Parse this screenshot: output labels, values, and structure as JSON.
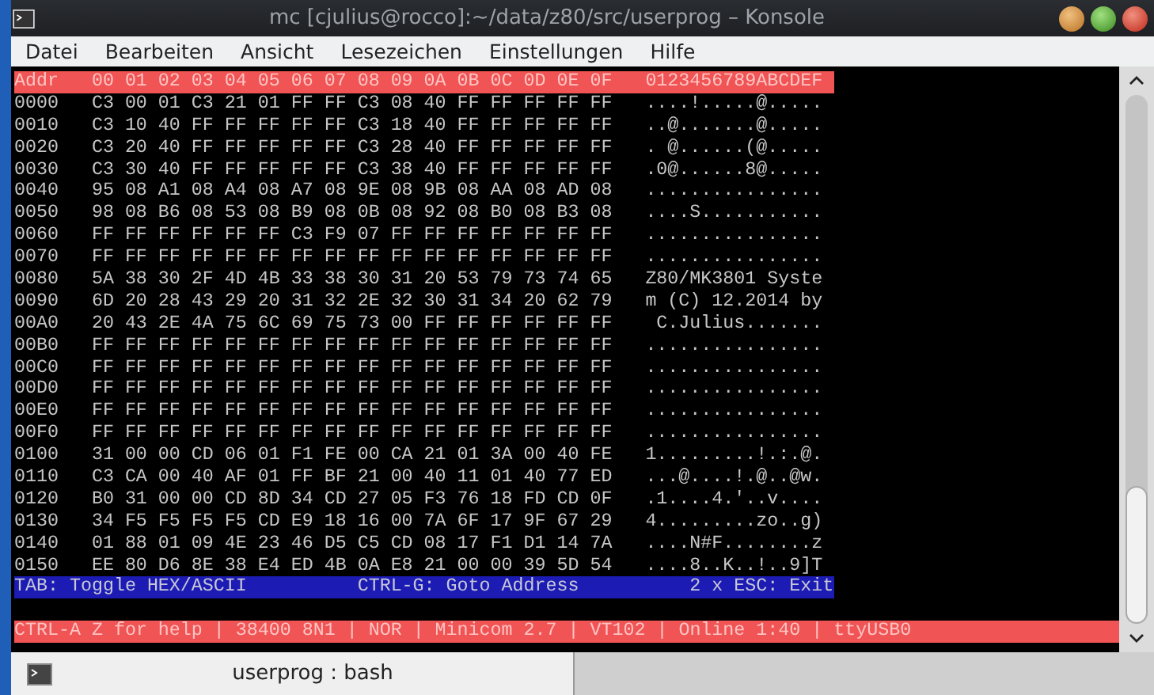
{
  "window": {
    "title": "mc [cjulius@rocco]:~/data/z80/src/userprog – Konsole"
  },
  "menu": [
    "Datei",
    "Bearbeiten",
    "Ansicht",
    "Lesezeichen",
    "Einstellungen",
    "Hilfe"
  ],
  "hexdump": {
    "header": {
      "addr": "Addr",
      "columns": "00 01 02 03 04 05 06 07 08 09 0A 0B 0C 0D 0E 0F",
      "ascii": "0123456789ABCDEF"
    },
    "rows": [
      {
        "addr": "0000",
        "hex": "C3 00 01 C3 21 01 FF FF C3 08 40 FF FF FF FF FF",
        "ascii": "....!.....@....."
      },
      {
        "addr": "0010",
        "hex": "C3 10 40 FF FF FF FF FF C3 18 40 FF FF FF FF FF",
        "ascii": "..@.......@....."
      },
      {
        "addr": "0020",
        "hex": "C3 20 40 FF FF FF FF FF C3 28 40 FF FF FF FF FF",
        "ascii": ". @......(@....."
      },
      {
        "addr": "0030",
        "hex": "C3 30 40 FF FF FF FF FF C3 38 40 FF FF FF FF FF",
        "ascii": ".0@......8@....."
      },
      {
        "addr": "0040",
        "hex": "95 08 A1 08 A4 08 A7 08 9E 08 9B 08 AA 08 AD 08",
        "ascii": "................"
      },
      {
        "addr": "0050",
        "hex": "98 08 B6 08 53 08 B9 08 0B 08 92 08 B0 08 B3 08",
        "ascii": "....S..........."
      },
      {
        "addr": "0060",
        "hex": "FF FF FF FF FF FF C3 F9 07 FF FF FF FF FF FF FF",
        "ascii": "................"
      },
      {
        "addr": "0070",
        "hex": "FF FF FF FF FF FF FF FF FF FF FF FF FF FF FF FF",
        "ascii": "................"
      },
      {
        "addr": "0080",
        "hex": "5A 38 30 2F 4D 4B 33 38 30 31 20 53 79 73 74 65",
        "ascii": "Z80/MK3801 Syste"
      },
      {
        "addr": "0090",
        "hex": "6D 20 28 43 29 20 31 32 2E 32 30 31 34 20 62 79",
        "ascii": "m (C) 12.2014 by"
      },
      {
        "addr": "00A0",
        "hex": "20 43 2E 4A 75 6C 69 75 73 00 FF FF FF FF FF FF",
        "ascii": " C.Julius......."
      },
      {
        "addr": "00B0",
        "hex": "FF FF FF FF FF FF FF FF FF FF FF FF FF FF FF FF",
        "ascii": "................"
      },
      {
        "addr": "00C0",
        "hex": "FF FF FF FF FF FF FF FF FF FF FF FF FF FF FF FF",
        "ascii": "................"
      },
      {
        "addr": "00D0",
        "hex": "FF FF FF FF FF FF FF FF FF FF FF FF FF FF FF FF",
        "ascii": "................"
      },
      {
        "addr": "00E0",
        "hex": "FF FF FF FF FF FF FF FF FF FF FF FF FF FF FF FF",
        "ascii": "................"
      },
      {
        "addr": "00F0",
        "hex": "FF FF FF FF FF FF FF FF FF FF FF FF FF FF FF FF",
        "ascii": "................"
      },
      {
        "addr": "0100",
        "hex": "31 00 00 CD 06 01 F1 FE 00 CA 21 01 3A 00 40 FE",
        "ascii": "1.........!.:.@."
      },
      {
        "addr": "0110",
        "hex": "C3 CA 00 40 AF 01 FF BF 21 00 40 11 01 40 77 ED",
        "ascii": "...@....!.@..@w."
      },
      {
        "addr": "0120",
        "hex": "B0 31 00 00 CD 8D 34 CD 27 05 F3 76 18 FD CD 0F",
        "ascii": ".1....4.'..v...."
      },
      {
        "addr": "0130",
        "hex": "34 F5 F5 F5 F5 CD E9 18 16 00 7A 6F 17 9F 67 29",
        "ascii": "4.........zo..g)"
      },
      {
        "addr": "0140",
        "hex": "01 88 01 09 4E 23 46 D5 C5 CD 08 17 F1 D1 14 7A",
        "ascii": "....N#F........z"
      },
      {
        "addr": "0150",
        "hex": "EE 80 D6 8E 38 E4 ED 4B 0A E8 21 00 00 39 5D 54",
        "ascii": "....8..K..!..9]T"
      }
    ]
  },
  "help_bar": [
    "TAB: Toggle HEX/ASCII",
    "CTRL-G: Goto Address",
    "2 x ESC: Exit"
  ],
  "status_line": "CTRL-A Z for help | 38400 8N1 | NOR | Minicom 2.7 | VT102 | Online 1:40 | ttyUSB0",
  "tabs": [
    {
      "label": "userprog : bash",
      "selected": true
    }
  ]
}
